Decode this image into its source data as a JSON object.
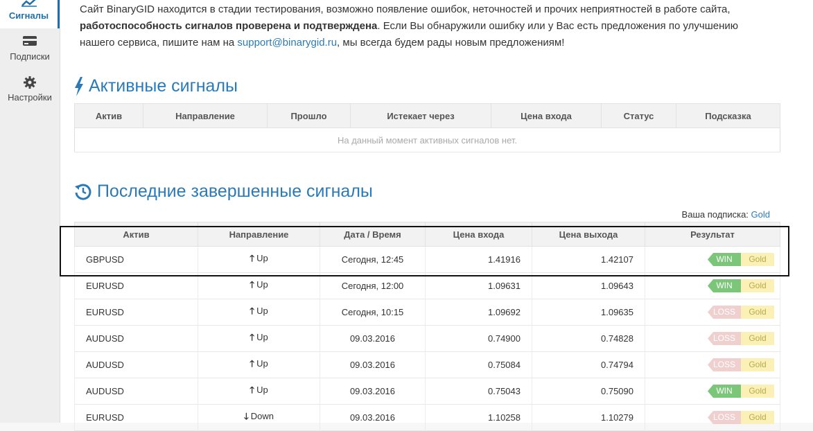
{
  "sidebar": {
    "items": [
      {
        "label": "Сигналы",
        "icon": "chart-line-icon"
      },
      {
        "label": "Подписки",
        "icon": "credit-card-icon"
      },
      {
        "label": "Настройки",
        "icon": "gear-icon"
      }
    ]
  },
  "notice": {
    "part1": "Сайт BinaryGID находится в стадии тестирования, возможно появление ошибок, неточностей и прочих неприятностей в работе сайта,",
    "bold": "работоспособность сигналов проверена и подтверждена",
    "part2": ". Если Вы обнаружили ошибку или у Вас есть предложения по улучшению нашего сервиса, пишите нам на",
    "email": "support@binarygid.ru",
    "part3": ", мы всегда будем рады новым предложениям!"
  },
  "active": {
    "title": "Активные сигналы",
    "headers": [
      "Актив",
      "Направление",
      "Прошло",
      "Истекает через",
      "Цена входа",
      "Статус",
      "Подсказка"
    ],
    "empty_text": "На данный момент активных сигналов нет."
  },
  "last": {
    "title": "Последние завершенные сигналы",
    "subscription_label": "Ваша подписка:",
    "subscription_value": "Gold",
    "headers": [
      "Актив",
      "Направление",
      "Дата / Время",
      "Цена входа",
      "Цена выхода",
      "Результат"
    ],
    "rows": [
      {
        "asset": "GBPUSD",
        "dir": "Up",
        "arrow": "🡑",
        "date": "Сегодня, 12:45",
        "entry": "1.41916",
        "exit": "1.42107",
        "result": "WIN",
        "plan": "Gold"
      },
      {
        "asset": "EURUSD",
        "dir": "Up",
        "arrow": "🡑",
        "date": "Сегодня, 12:00",
        "entry": "1.09631",
        "exit": "1.09643",
        "result": "WIN",
        "plan": "Gold"
      },
      {
        "asset": "EURUSD",
        "dir": "Up",
        "arrow": "🡑",
        "date": "Сегодня, 10:15",
        "entry": "1.09692",
        "exit": "1.09635",
        "result": "LOSS",
        "plan": "Gold"
      },
      {
        "asset": "AUDUSD",
        "dir": "Up",
        "arrow": "🡑",
        "date": "09.03.2016",
        "entry": "0.74900",
        "exit": "0.74828",
        "result": "LOSS",
        "plan": "Gold"
      },
      {
        "asset": "AUDUSD",
        "dir": "Up",
        "arrow": "🡑",
        "date": "09.03.2016",
        "entry": "0.75084",
        "exit": "0.74794",
        "result": "LOSS",
        "plan": "Gold"
      },
      {
        "asset": "AUDUSD",
        "dir": "Up",
        "arrow": "🡑",
        "date": "09.03.2016",
        "entry": "0.75043",
        "exit": "0.75090",
        "result": "WIN",
        "plan": "Gold"
      },
      {
        "asset": "EURUSD",
        "dir": "Down",
        "arrow": "🡓",
        "date": "09.03.2016",
        "entry": "1.10258",
        "exit": "1.10279",
        "result": "LOSS",
        "plan": "Gold"
      }
    ]
  },
  "colors": {
    "accent": "#2a7ab8",
    "win": "#7cc67a",
    "loss": "#f0cfcf",
    "gold": "#fbf1b6"
  }
}
